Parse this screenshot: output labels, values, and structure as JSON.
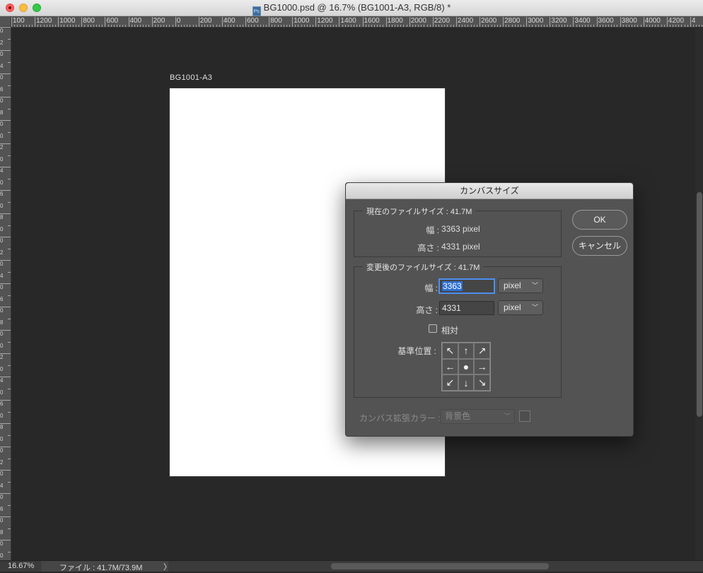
{
  "window": {
    "title": "BG1000.psd @ 16.7% (BG1001-A3, RGB/8) *"
  },
  "rulers": {
    "top_labels": [
      "100",
      "1200",
      "1000",
      "800",
      "600",
      "400",
      "200",
      "0",
      "200",
      "400",
      "600",
      "800",
      "1000",
      "1200",
      "1400",
      "1600",
      "1800",
      "2000",
      "2200",
      "2400",
      "2600",
      "2800",
      "3000",
      "3200",
      "3400",
      "3600",
      "3800",
      "4000",
      "4200",
      "4"
    ],
    "left_labels": [
      "0",
      "2",
      "0",
      "4",
      "0",
      "6",
      "0",
      "8",
      "0",
      "0",
      "2",
      "0",
      "4",
      "0",
      "6",
      "0",
      "8",
      "0",
      "0",
      "2",
      "0",
      "4",
      "0",
      "6",
      "0",
      "8",
      "0",
      "0",
      "2",
      "0",
      "4",
      "0",
      "6",
      "0",
      "8",
      "0",
      "0",
      "2",
      "0",
      "4",
      "0",
      "6",
      "0",
      "8",
      "0",
      "0",
      "2",
      "0",
      "4",
      "0"
    ]
  },
  "document": {
    "label": "BG1001-A3"
  },
  "statusbar": {
    "zoom": "16.67%",
    "file": "ファイル : 41.7M/73.9M",
    "arrow": "〉"
  },
  "dialog": {
    "title": "カンバスサイズ",
    "current": {
      "legend": "現在のファイルサイズ : 41.7M",
      "width_label": "幅 :",
      "width_value": "3363 pixel",
      "height_label": "高さ :",
      "height_value": "4331 pixel"
    },
    "new": {
      "legend": "変更後のファイルサイズ : 41.7M",
      "width_label": "幅 :",
      "width_value": "3363",
      "width_unit": "pixel",
      "height_label": "高さ :",
      "height_value": "4331",
      "height_unit": "pixel",
      "relative_label": "相対",
      "anchor_label": "基準位置 :"
    },
    "extension_label": "カンバス拡張カラー :",
    "extension_value": "背景色",
    "ok": "OK",
    "cancel": "キャンセル"
  }
}
